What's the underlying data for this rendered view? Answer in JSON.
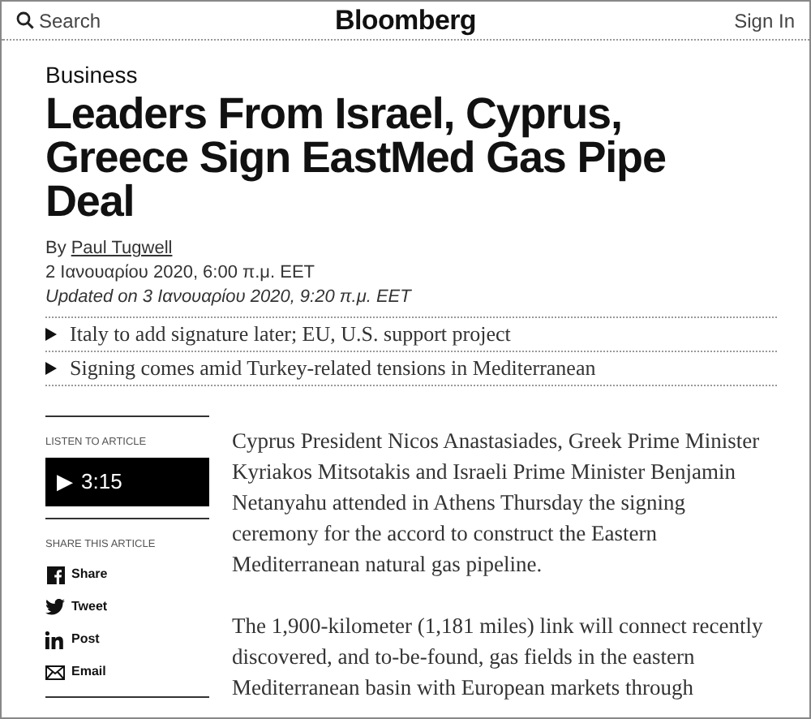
{
  "header": {
    "search": "Search",
    "logo": "Bloomberg",
    "sign_in": "Sign In"
  },
  "article": {
    "section": "Business",
    "headline": "Leaders From Israel, Cyprus, Greece Sign EastMed Gas Pipe Deal",
    "byline_prefix": "By",
    "author": "Paul Tugwell",
    "published": "2 Ιανουαρίου 2020, 6:00 π.μ. EET",
    "updated": "Updated on 3 Ιανουαρίου 2020, 9:20 π.μ. EET",
    "bullets": [
      "Italy to add signature later; EU, U.S. support project",
      "Signing comes amid Turkey-related tensions in Mediterranean"
    ],
    "listen": {
      "label": "LISTEN TO ARTICLE",
      "icon": "▶",
      "duration": "3:15"
    },
    "share": {
      "label": "SHARE THIS ARTICLE",
      "items": [
        {
          "kind": "facebook",
          "label": "Share"
        },
        {
          "kind": "twitter",
          "label": "Tweet"
        },
        {
          "kind": "linkedin",
          "label": "Post"
        },
        {
          "kind": "email",
          "label": "Email"
        }
      ]
    },
    "paragraphs": [
      "Cyprus President Nicos Anastasiades, Greek Prime Minister Kyriakos Mitsotakis and Israeli Prime Minister Benjamin Netanyahu attended in Athens Thursday the signing ceremony for the accord to construct the Eastern Mediterranean natural gas pipeline.",
      "The 1,900-kilometer (1,181 miles) link will connect recently discovered, and to-be-found, gas fields in the eastern Mediterranean basin with European markets through"
    ]
  }
}
